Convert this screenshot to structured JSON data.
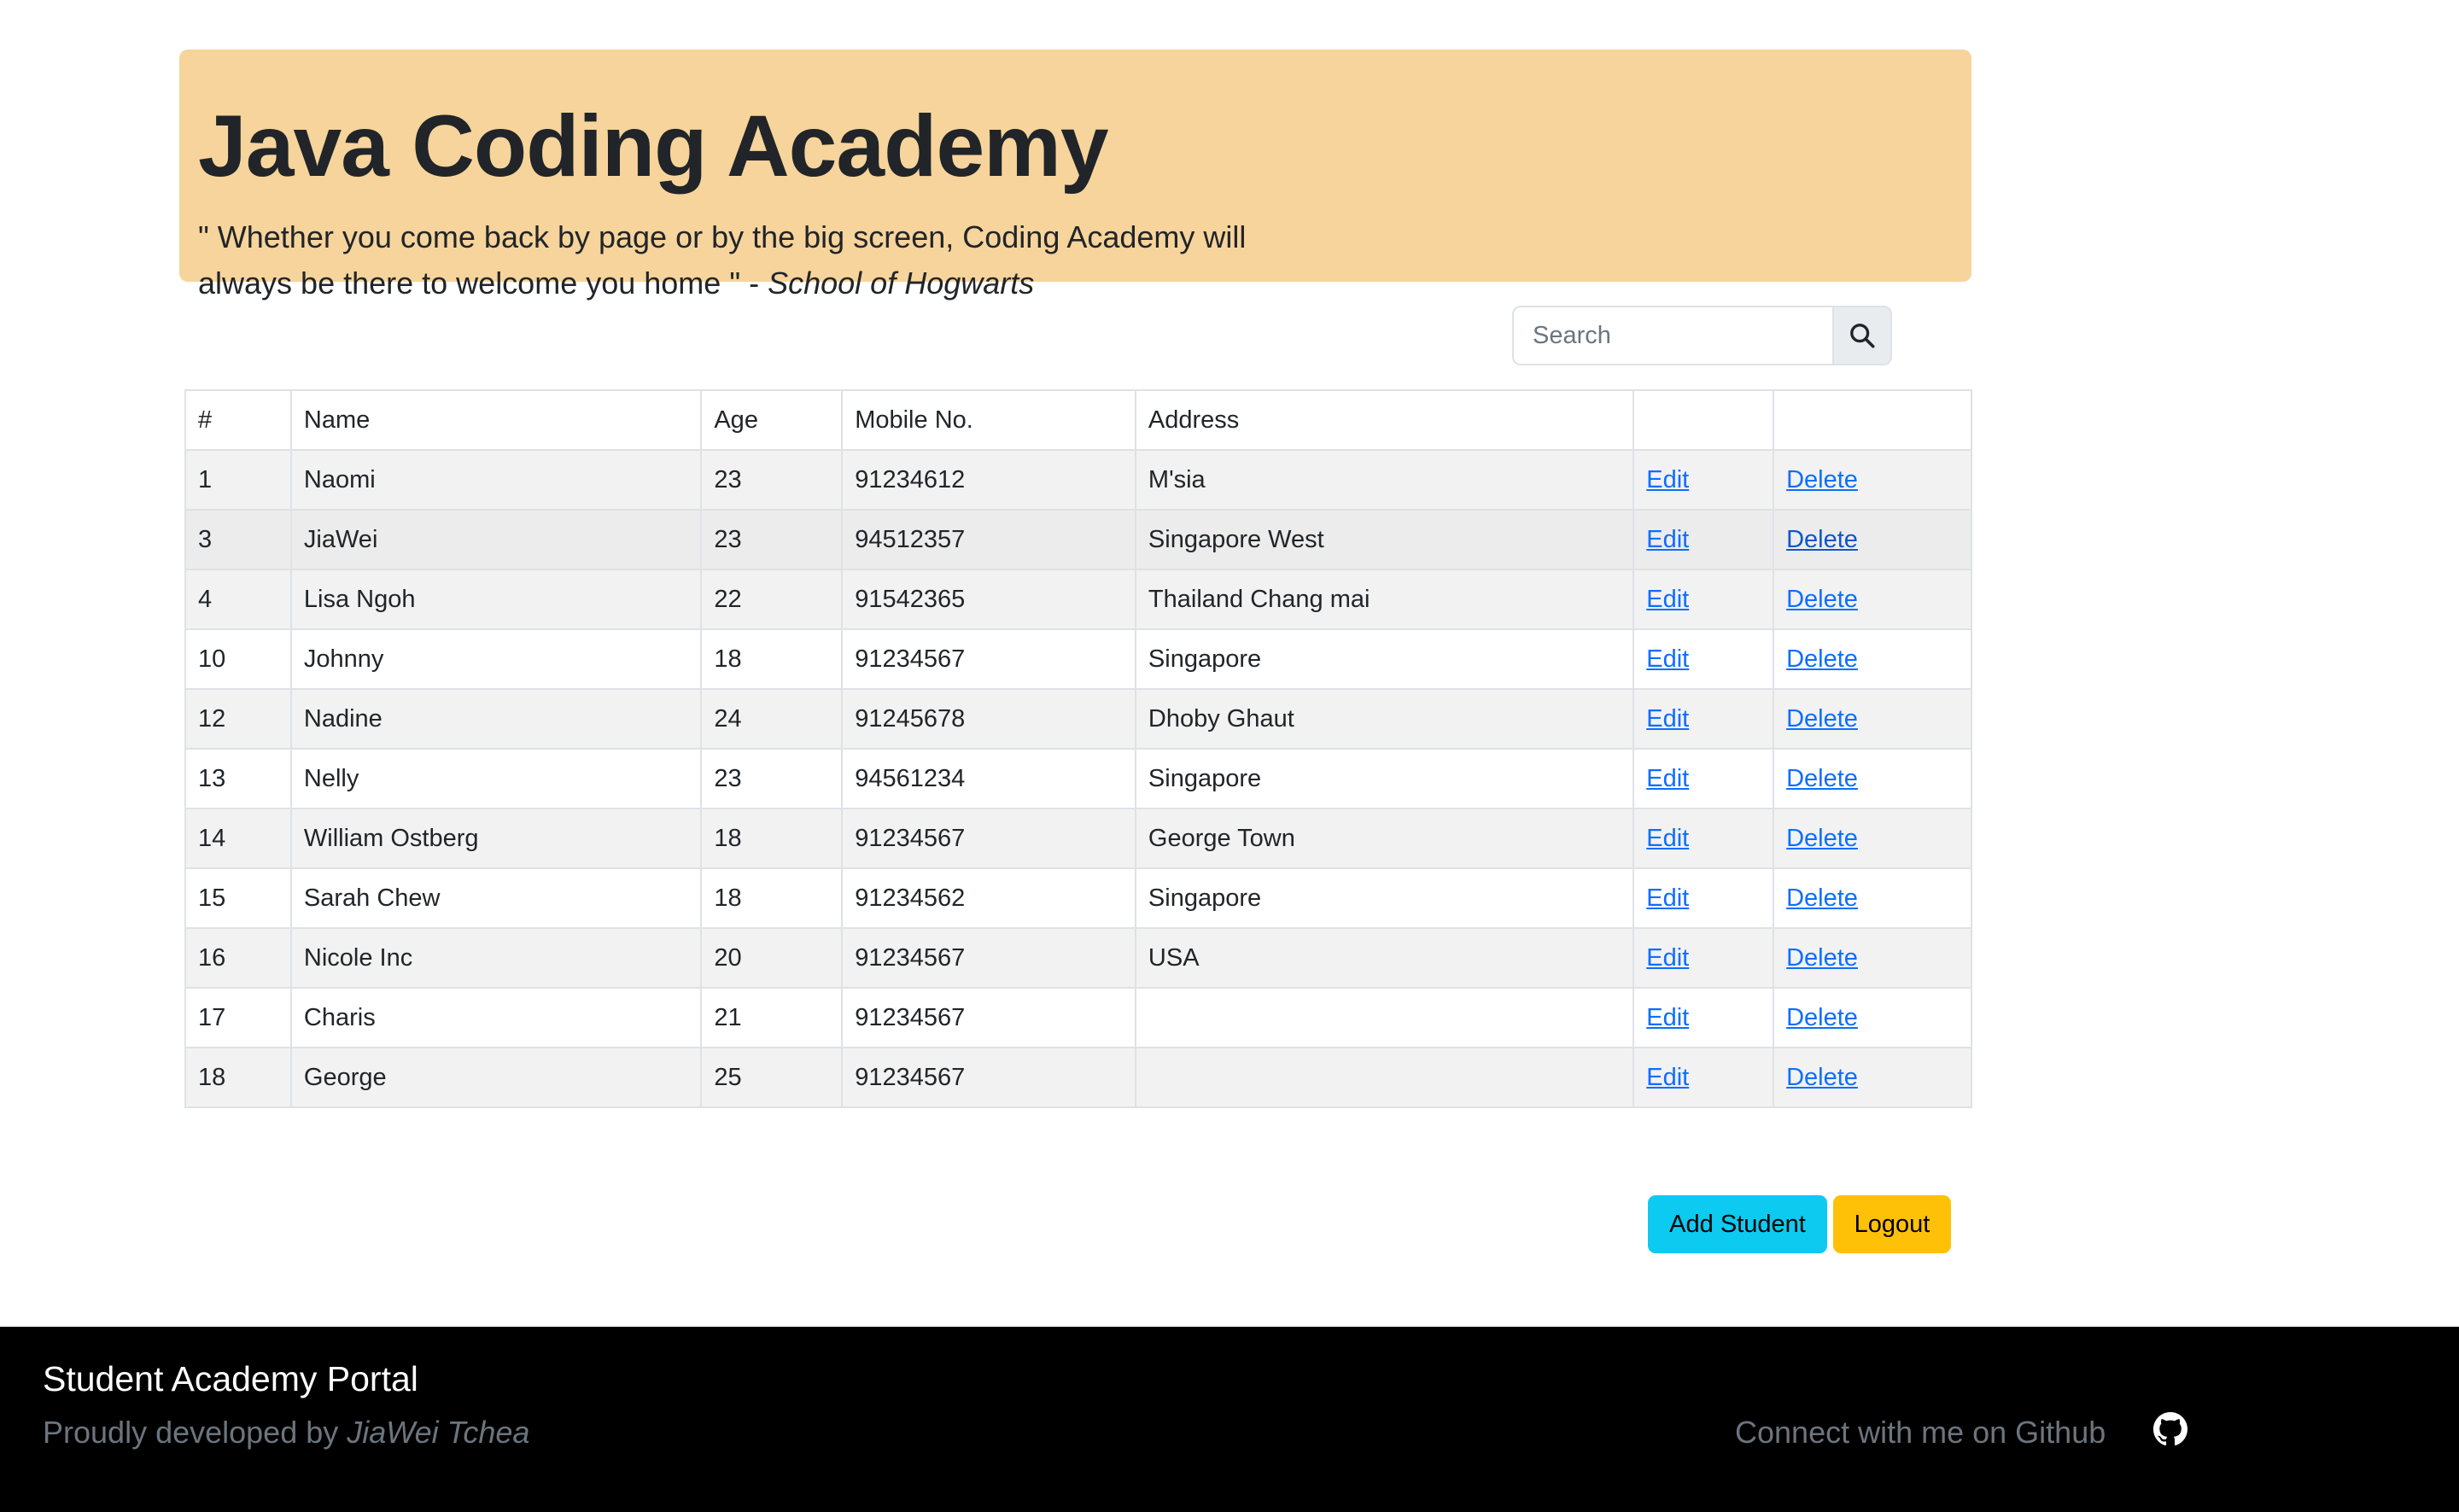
{
  "header": {
    "title": "Java Coding Academy",
    "quote_text": "\" Whether you come back by page or by the big screen, Coding Academy will always be there to welcome you home \" -",
    "quote_source": "School of Hogwarts",
    "background_color": "#f7d49b"
  },
  "search": {
    "placeholder": "Search",
    "value": "",
    "button_icon": "search-icon"
  },
  "table": {
    "columns": [
      "#",
      "Name",
      "Age",
      "Mobile No.",
      "Address",
      "",
      ""
    ],
    "rows": [
      {
        "id": "1",
        "name": "Naomi",
        "age": "23",
        "mobile": "91234612",
        "address": "M'sia",
        "edit": "Edit",
        "delete": "Delete"
      },
      {
        "id": "3",
        "name": "JiaWei",
        "age": "23",
        "mobile": "94512357",
        "address": "Singapore West",
        "edit": "Edit",
        "delete": "Delete"
      },
      {
        "id": "4",
        "name": "Lisa Ngoh",
        "age": "22",
        "mobile": "91542365",
        "address": "Thailand Chang mai",
        "edit": "Edit",
        "delete": "Delete"
      },
      {
        "id": "10",
        "name": "Johnny",
        "age": "18",
        "mobile": "91234567",
        "address": "Singapore",
        "edit": "Edit",
        "delete": "Delete"
      },
      {
        "id": "12",
        "name": "Nadine",
        "age": "24",
        "mobile": "91245678",
        "address": "Dhoby Ghaut",
        "edit": "Edit",
        "delete": "Delete"
      },
      {
        "id": "13",
        "name": "Nelly",
        "age": "23",
        "mobile": "94561234",
        "address": "Singapore",
        "edit": "Edit",
        "delete": "Delete"
      },
      {
        "id": "14",
        "name": "William Ostberg",
        "age": "18",
        "mobile": "91234567",
        "address": "George Town",
        "edit": "Edit",
        "delete": "Delete"
      },
      {
        "id": "15",
        "name": "Sarah Chew",
        "age": "18",
        "mobile": "91234562",
        "address": "Singapore",
        "edit": "Edit",
        "delete": "Delete"
      },
      {
        "id": "16",
        "name": "Nicole Inc",
        "age": "20",
        "mobile": "91234567",
        "address": "USA",
        "edit": "Edit",
        "delete": "Delete"
      },
      {
        "id": "17",
        "name": "Charis",
        "age": "21",
        "mobile": "91234567",
        "address": "",
        "edit": "Edit",
        "delete": "Delete"
      },
      {
        "id": "18",
        "name": "George",
        "age": "25",
        "mobile": "91234567",
        "address": "",
        "edit": "Edit",
        "delete": "Delete"
      }
    ],
    "link_color": "#0d6efd"
  },
  "actions": {
    "add_label": "Add Student",
    "add_color": "#0dcaf0",
    "logout_label": "Logout",
    "logout_color": "#ffc107"
  },
  "footer": {
    "title": "Student Academy Portal",
    "developed_prefix": "Proudly developed by",
    "developer": "JiaWei Tchea",
    "connect_text": "Connect with me on Github",
    "connect_icon": "github-icon"
  }
}
